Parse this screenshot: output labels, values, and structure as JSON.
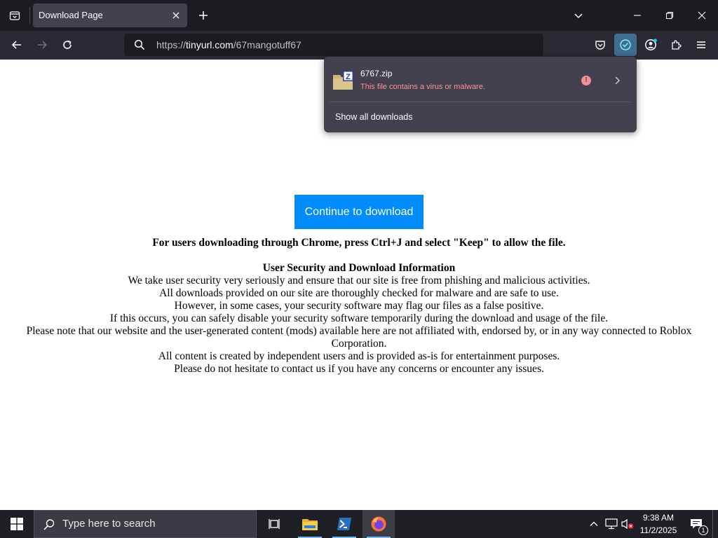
{
  "browser": {
    "tab": {
      "title": "Download Page"
    },
    "url": {
      "scheme": "https://",
      "host": "tinyurl.com",
      "path": "/67mangotuff67"
    }
  },
  "downloads_panel": {
    "item": {
      "file_name": "6767.zip",
      "status": "This file contains a virus or malware.",
      "warning_badge": "!"
    },
    "show_all": "Show all downloads"
  },
  "page": {
    "button_label": "Continue to download",
    "chrome_notice": "For users downloading through Chrome, press Ctrl+J and select \"Keep\" to allow the file.",
    "info_heading": "User Security and Download Information",
    "info_lines": [
      "We take user security very seriously and ensure that our site is free from phishing and malicious activities.",
      "All downloads provided on our site are thoroughly checked for malware and are safe to use.",
      "However, in some cases, your security software may flag our files as a false positive.",
      "If this occurs, you can safely disable your security software temporarily during the download and usage of the file.",
      "Please note that our website and the user-generated content (mods) available here are not affiliated with, endorsed by, or in any way connected to Roblox Corporation.",
      "All content is created by independent users and is provided as-is for entertainment purposes.",
      "Please do not hesitate to contact us if you have any concerns or encounter any issues."
    ]
  },
  "taskbar": {
    "search_placeholder": "Type here to search",
    "time": "9:38 AM",
    "date": "11/2/2025",
    "notification_count": "1",
    "apps": [
      "task-view-icon",
      "file-explorer-icon",
      "powershell-icon",
      "firefox-icon"
    ]
  },
  "colors": {
    "chrome_dark": "#1c1b22",
    "toolbar": "#2b2a33",
    "panel": "#42414d",
    "cta_blue": "#008cff",
    "warning_red": "#ff8f95",
    "taskbar": "#1f2026"
  }
}
